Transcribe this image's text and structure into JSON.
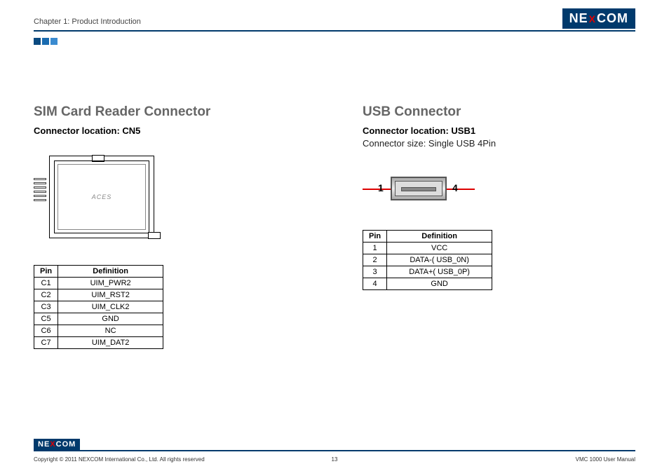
{
  "header": {
    "chapter": "Chapter 1: Product Introduction",
    "logo_left": "NE",
    "logo_mid": "X",
    "logo_right": "COM"
  },
  "left_section": {
    "title": "SIM Card Reader Connector",
    "subtitle": "Connector location: CN5",
    "brand_on_chip": "ACES",
    "table": {
      "headers": {
        "pin": "Pin",
        "def": "Definition"
      },
      "rows": [
        {
          "pin": "C1",
          "def": "UIM_PWR2"
        },
        {
          "pin": "C2",
          "def": "UIM_RST2"
        },
        {
          "pin": "C3",
          "def": "UIM_CLK2"
        },
        {
          "pin": "C5",
          "def": "GND"
        },
        {
          "pin": "C6",
          "def": "NC"
        },
        {
          "pin": "C7",
          "def": "UIM_DAT2"
        }
      ]
    }
  },
  "right_section": {
    "title": "USB Connector",
    "subtitle": "Connector location: USB1",
    "subtext": "Connector size: Single USB 4Pin",
    "pin_left": "1",
    "pin_right": "4",
    "table": {
      "headers": {
        "pin": "Pin",
        "def": "Definition"
      },
      "rows": [
        {
          "pin": "1",
          "def": "VCC"
        },
        {
          "pin": "2",
          "def": "DATA-( USB_0N)"
        },
        {
          "pin": "3",
          "def": "DATA+( USB_0P)"
        },
        {
          "pin": "4",
          "def": "GND"
        }
      ]
    }
  },
  "footer": {
    "logo_left": "NE",
    "logo_mid": "X",
    "logo_right": "COM",
    "copyright": "Copyright © 2011 NEXCOM International Co., Ltd. All rights reserved",
    "page": "13",
    "manual": "VMC 1000 User Manual"
  }
}
